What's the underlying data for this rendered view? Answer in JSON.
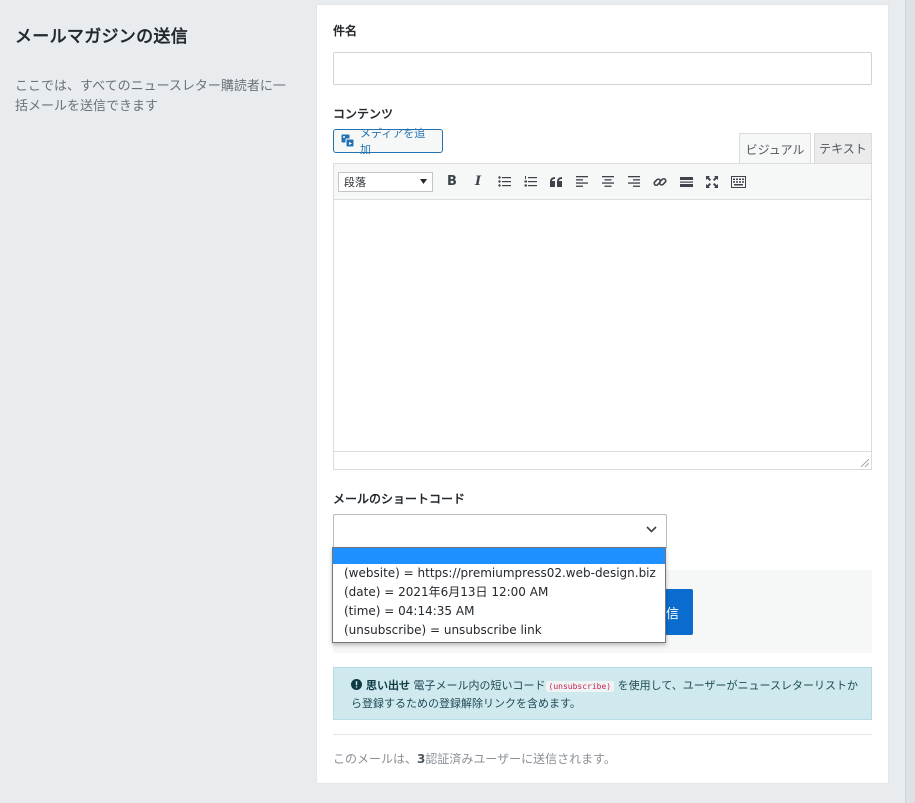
{
  "sidebar": {
    "title": "メールマガジンの送信",
    "description": "ここでは、すべてのニュースレター購読者に一括メールを送信できます"
  },
  "form": {
    "subject_label": "件名",
    "subject_value": "",
    "content_label": "コンテンツ",
    "add_media_label": "メディアを追加",
    "tabs": {
      "visual": "ビジュアル",
      "text": "テキスト"
    },
    "format_select": "段落",
    "toolbar_icons": [
      "bold-icon",
      "italic-icon",
      "bullet-list-icon",
      "numbered-list-icon",
      "blockquote-icon",
      "align-left-icon",
      "align-center-icon",
      "align-right-icon",
      "link-icon",
      "read-more-icon",
      "fullscreen-icon",
      "toolbar-toggle-icon"
    ],
    "shortcode_label": "メールのショートコード",
    "shortcode_selected": "",
    "shortcode_options": [
      "",
      "(website) = https://premiumpress02.web-design.biz",
      "(date) = 2021年6月13日 12:00 AM",
      "(time) = 04:14:35 AM",
      "(unsubscribe) = unsubscribe link"
    ],
    "send_button_label": "信"
  },
  "notice": {
    "strong": "思い出せ",
    "text_before": "電子メール内の短いコード",
    "code": "(unsubscribe)",
    "text_after": "を使用して、ユーザーがニュースレターリストから登録するための登録解除リンクを含めます。"
  },
  "footer": {
    "prefix": "このメールは、",
    "count": "3",
    "suffix": "認証済みユーザーに送信されます。"
  },
  "colors": {
    "accent": "#0b6ccf",
    "dropdown_highlight": "#1e90ff",
    "notice_bg": "#cfe9ee"
  }
}
